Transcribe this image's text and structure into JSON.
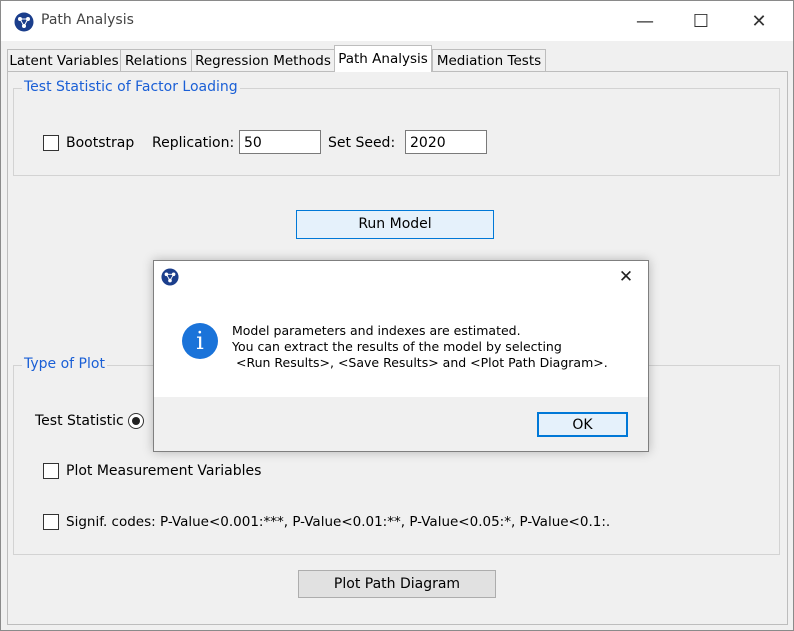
{
  "window": {
    "title": "Path Analysis",
    "minimize_glyph": "—",
    "maximize_glyph": "☐",
    "close_glyph": "✕"
  },
  "tabs": [
    {
      "label": "Latent Variables",
      "active": false
    },
    {
      "label": "Relations",
      "active": false
    },
    {
      "label": "Regression Methods",
      "active": false
    },
    {
      "label": "Path Analysis",
      "active": true
    },
    {
      "label": "Mediation Tests",
      "active": false
    }
  ],
  "test_statistic_group": {
    "title": "Test Statistic of Factor Loading",
    "bootstrap_label": "Bootstrap",
    "bootstrap_checked": false,
    "replication_label": "Replication:",
    "replication_value": "50",
    "seed_label": "Set Seed:",
    "seed_value": "2020"
  },
  "run_model_label": "Run Model",
  "plot_group": {
    "title": "Type of Plot",
    "test_statistic_label": "Test Statistic",
    "test_statistic_selected": true,
    "measurement_label": "Plot Measurement Variables",
    "measurement_checked": false,
    "signif_label": "Signif. codes:  P-Value<0.001:***, P-Value<0.01:**, P-Value<0.05:*, P-Value<0.1:.",
    "signif_checked": false
  },
  "plot_path_label": "Plot Path Diagram",
  "dialog": {
    "close_glyph": "✕",
    "info_glyph": "i",
    "message_lines": [
      "Model parameters and indexes are estimated.",
      "You can extract the results of the model by selecting",
      " <Run Results>, <Save Results> and <Plot Path Diagram>."
    ],
    "ok_label": "OK"
  },
  "colors": {
    "accent_blue": "#1a5fd6",
    "info_icon": "#1a73d9",
    "focus_border": "#0078d7"
  }
}
